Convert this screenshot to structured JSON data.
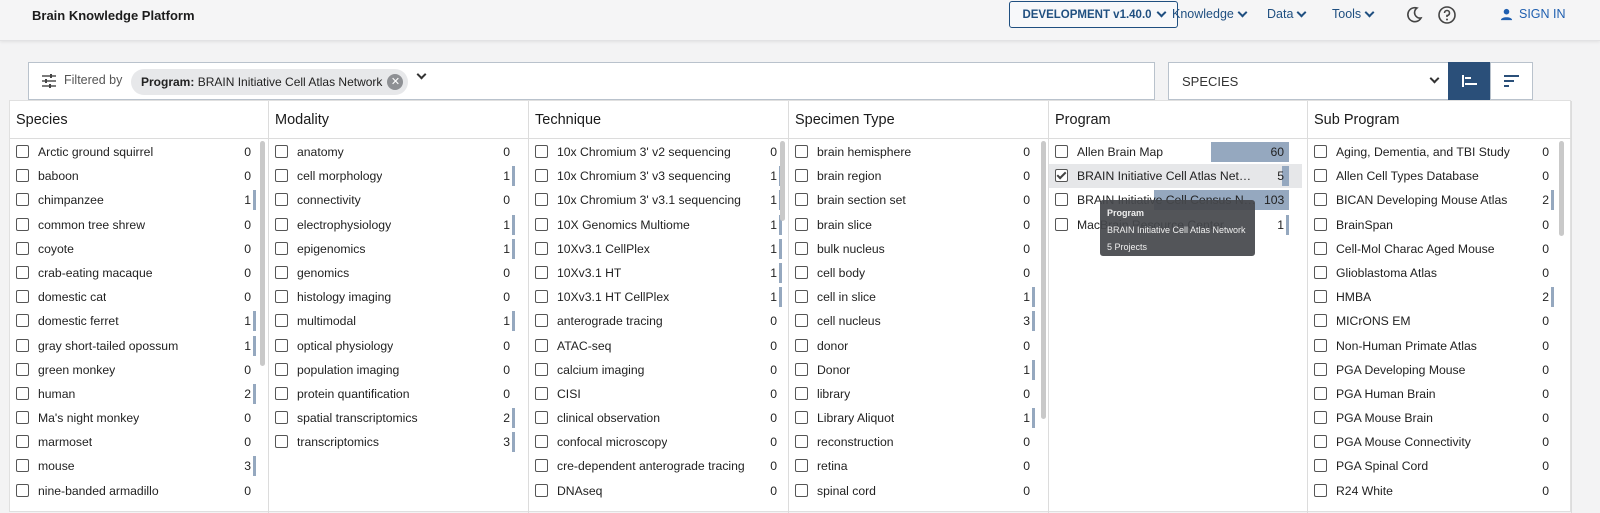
{
  "header": {
    "brand": "Brain Knowledge Platform",
    "env_label": "DEVELOPMENT v1.40.0",
    "nav": [
      "Knowledge",
      "Data",
      "Tools"
    ],
    "signin": "SIGN IN"
  },
  "filter": {
    "label": "Filtered by",
    "chip_key": "Program:",
    "chip_value": "BRAIN Initiative Cell Atlas Network"
  },
  "group_by": {
    "value": "SPECIES"
  },
  "columns": [
    {
      "title": "Species",
      "rows": [
        {
          "label": "Arctic ground squirrel",
          "count": "0",
          "bar": 0
        },
        {
          "label": "baboon",
          "count": "0",
          "bar": 0
        },
        {
          "label": "chimpanzee",
          "count": "1",
          "bar": 0.01
        },
        {
          "label": "common tree shrew",
          "count": "0",
          "bar": 0
        },
        {
          "label": "coyote",
          "count": "0",
          "bar": 0
        },
        {
          "label": "crab-eating macaque",
          "count": "0",
          "bar": 0
        },
        {
          "label": "domestic cat",
          "count": "0",
          "bar": 0
        },
        {
          "label": "domestic ferret",
          "count": "1",
          "bar": 0.01
        },
        {
          "label": "gray short-tailed opossum",
          "count": "1",
          "bar": 0.01
        },
        {
          "label": "green monkey",
          "count": "0",
          "bar": 0
        },
        {
          "label": "human",
          "count": "2",
          "bar": 0.02
        },
        {
          "label": "Ma's night monkey",
          "count": "0",
          "bar": 0
        },
        {
          "label": "marmoset",
          "count": "0",
          "bar": 0
        },
        {
          "label": "mouse",
          "count": "3",
          "bar": 0.02
        },
        {
          "label": "nine-banded armadillo",
          "count": "0",
          "bar": 0
        }
      ]
    },
    {
      "title": "Modality",
      "rows": [
        {
          "label": "anatomy",
          "count": "0",
          "bar": 0
        },
        {
          "label": "cell morphology",
          "count": "1",
          "bar": 0.01
        },
        {
          "label": "connectivity",
          "count": "0",
          "bar": 0
        },
        {
          "label": "electrophysiology",
          "count": "1",
          "bar": 0.01
        },
        {
          "label": "epigenomics",
          "count": "1",
          "bar": 0.01
        },
        {
          "label": "genomics",
          "count": "0",
          "bar": 0
        },
        {
          "label": "histology imaging",
          "count": "0",
          "bar": 0
        },
        {
          "label": "multimodal",
          "count": "1",
          "bar": 0.01
        },
        {
          "label": "optical physiology",
          "count": "0",
          "bar": 0
        },
        {
          "label": "population imaging",
          "count": "0",
          "bar": 0
        },
        {
          "label": "protein quantification",
          "count": "0",
          "bar": 0
        },
        {
          "label": "spatial transcriptomics",
          "count": "2",
          "bar": 0.02
        },
        {
          "label": "transcriptomics",
          "count": "3",
          "bar": 0.04
        }
      ]
    },
    {
      "title": "Technique",
      "rows": [
        {
          "label": "10x Chromium 3' v2 sequencing",
          "count": "0",
          "bar": 0
        },
        {
          "label": "10x Chromium 3' v3 sequencing",
          "count": "1",
          "bar": 0.04
        },
        {
          "label": "10x Chromium 3' v3.1 sequencing",
          "count": "1",
          "bar": 0.04
        },
        {
          "label": "10X Genomics Multiome",
          "count": "1",
          "bar": 0.04
        },
        {
          "label": "10Xv3.1 CellPlex",
          "count": "1",
          "bar": 0.04
        },
        {
          "label": "10Xv3.1 HT",
          "count": "1",
          "bar": 0.04
        },
        {
          "label": "10Xv3.1 HT CellPlex",
          "count": "1",
          "bar": 0.04
        },
        {
          "label": "anterograde tracing",
          "count": "0",
          "bar": 0
        },
        {
          "label": "ATAC-seq",
          "count": "0",
          "bar": 0
        },
        {
          "label": "calcium imaging",
          "count": "0",
          "bar": 0
        },
        {
          "label": "CISI",
          "count": "0",
          "bar": 0
        },
        {
          "label": "clinical observation",
          "count": "0",
          "bar": 0
        },
        {
          "label": "confocal microscopy",
          "count": "0",
          "bar": 0
        },
        {
          "label": "cre-dependent anterograde tracing",
          "count": "0",
          "bar": 0
        },
        {
          "label": "DNAseq",
          "count": "0",
          "bar": 0
        }
      ]
    },
    {
      "title": "Specimen Type",
      "rows": [
        {
          "label": "brain hemisphere",
          "count": "0",
          "bar": 0
        },
        {
          "label": "brain region",
          "count": "0",
          "bar": 0
        },
        {
          "label": "brain section set",
          "count": "0",
          "bar": 0
        },
        {
          "label": "brain slice",
          "count": "0",
          "bar": 0
        },
        {
          "label": "bulk nucleus",
          "count": "0",
          "bar": 0
        },
        {
          "label": "cell body",
          "count": "0",
          "bar": 0
        },
        {
          "label": "cell in slice",
          "count": "1",
          "bar": 0.01
        },
        {
          "label": "cell nucleus",
          "count": "3",
          "bar": 0.04
        },
        {
          "label": "donor",
          "count": "0",
          "bar": 0
        },
        {
          "label": "Donor",
          "count": "1",
          "bar": 0.01
        },
        {
          "label": "library",
          "count": "0",
          "bar": 0
        },
        {
          "label": "Library Aliquot",
          "count": "1",
          "bar": 0.01
        },
        {
          "label": "reconstruction",
          "count": "0",
          "bar": 0
        },
        {
          "label": "retina",
          "count": "0",
          "bar": 0
        },
        {
          "label": "spinal cord",
          "count": "0",
          "bar": 0
        }
      ]
    },
    {
      "title": "Program",
      "rows": [
        {
          "label": "Allen Brain Map",
          "count": "60",
          "bar": 0.58,
          "checked": false
        },
        {
          "label": "BRAIN Initiative Cell Atlas Network",
          "count": "5",
          "bar": 0.05,
          "checked": true
        },
        {
          "label": "BRAIN Initiative Cell Census Network",
          "count": "103",
          "bar": 1.0,
          "checked": false
        },
        {
          "label": "MacBrain Resource Center",
          "count": "1",
          "bar": 0.01,
          "checked": false
        }
      ]
    },
    {
      "title": "Sub Program",
      "rows": [
        {
          "label": "Aging, Dementia, and TBI Study",
          "count": "0",
          "bar": 0
        },
        {
          "label": "Allen Cell Types Database",
          "count": "0",
          "bar": 0
        },
        {
          "label": "BICAN Developing Mouse Atlas",
          "count": "2",
          "bar": 0.06
        },
        {
          "label": "BrainSpan",
          "count": "0",
          "bar": 0
        },
        {
          "label": "Cell-Mol Charac Aged Mouse",
          "count": "0",
          "bar": 0
        },
        {
          "label": "Glioblastoma Atlas",
          "count": "0",
          "bar": 0
        },
        {
          "label": "HMBA",
          "count": "2",
          "bar": 0.06
        },
        {
          "label": "MICrONS EM",
          "count": "0",
          "bar": 0
        },
        {
          "label": "Non-Human Primate Atlas",
          "count": "0",
          "bar": 0
        },
        {
          "label": "PGA Developing Mouse",
          "count": "0",
          "bar": 0
        },
        {
          "label": "PGA Human Brain",
          "count": "0",
          "bar": 0
        },
        {
          "label": "PGA Mouse Brain",
          "count": "0",
          "bar": 0
        },
        {
          "label": "PGA Mouse Connectivity",
          "count": "0",
          "bar": 0
        },
        {
          "label": "PGA Spinal Cord",
          "count": "0",
          "bar": 0
        },
        {
          "label": "R24 White",
          "count": "0",
          "bar": 0
        }
      ]
    }
  ],
  "tooltip": {
    "category": "Program",
    "name": "BRAIN Initiative Cell Atlas Network",
    "detail": "5 Projects"
  },
  "colors": {
    "accent": "#1f4f80",
    "bar": "#95a8bf",
    "active_sort": "#2a4f79"
  }
}
